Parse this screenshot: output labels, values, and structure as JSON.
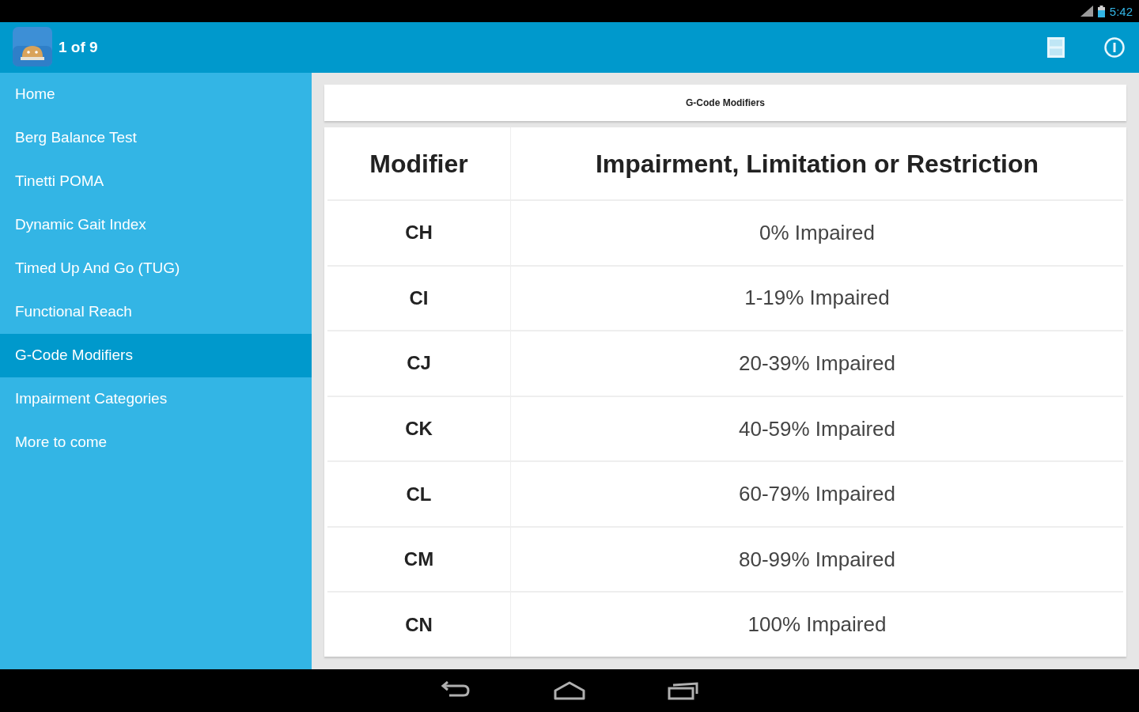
{
  "status_bar": {
    "time": "5:42"
  },
  "action_bar": {
    "title": "1 of 9"
  },
  "sidebar": {
    "items": [
      {
        "label": "Home",
        "selected": false
      },
      {
        "label": "Berg Balance Test",
        "selected": false
      },
      {
        "label": "Tinetti POMA",
        "selected": false
      },
      {
        "label": "Dynamic Gait Index",
        "selected": false
      },
      {
        "label": "Timed Up And Go (TUG)",
        "selected": false
      },
      {
        "label": "Functional Reach",
        "selected": false
      },
      {
        "label": "G-Code Modifiers",
        "selected": true
      },
      {
        "label": "Impairment Categories",
        "selected": false
      },
      {
        "label": "More to come",
        "selected": false
      }
    ]
  },
  "content": {
    "title": "G-Code Modifiers",
    "table": {
      "columns": [
        "Modifier",
        "Impairment, Limitation or Restriction"
      ],
      "rows": [
        {
          "modifier": "CH",
          "impairment": "0% Impaired"
        },
        {
          "modifier": "CI",
          "impairment": "1-19% Impaired"
        },
        {
          "modifier": "CJ",
          "impairment": "20-39% Impaired"
        },
        {
          "modifier": "CK",
          "impairment": "40-59% Impaired"
        },
        {
          "modifier": "CL",
          "impairment": "60-79% Impaired"
        },
        {
          "modifier": "CM",
          "impairment": "80-99% Impaired"
        },
        {
          "modifier": "CN",
          "impairment": "100% Impaired"
        }
      ]
    }
  }
}
